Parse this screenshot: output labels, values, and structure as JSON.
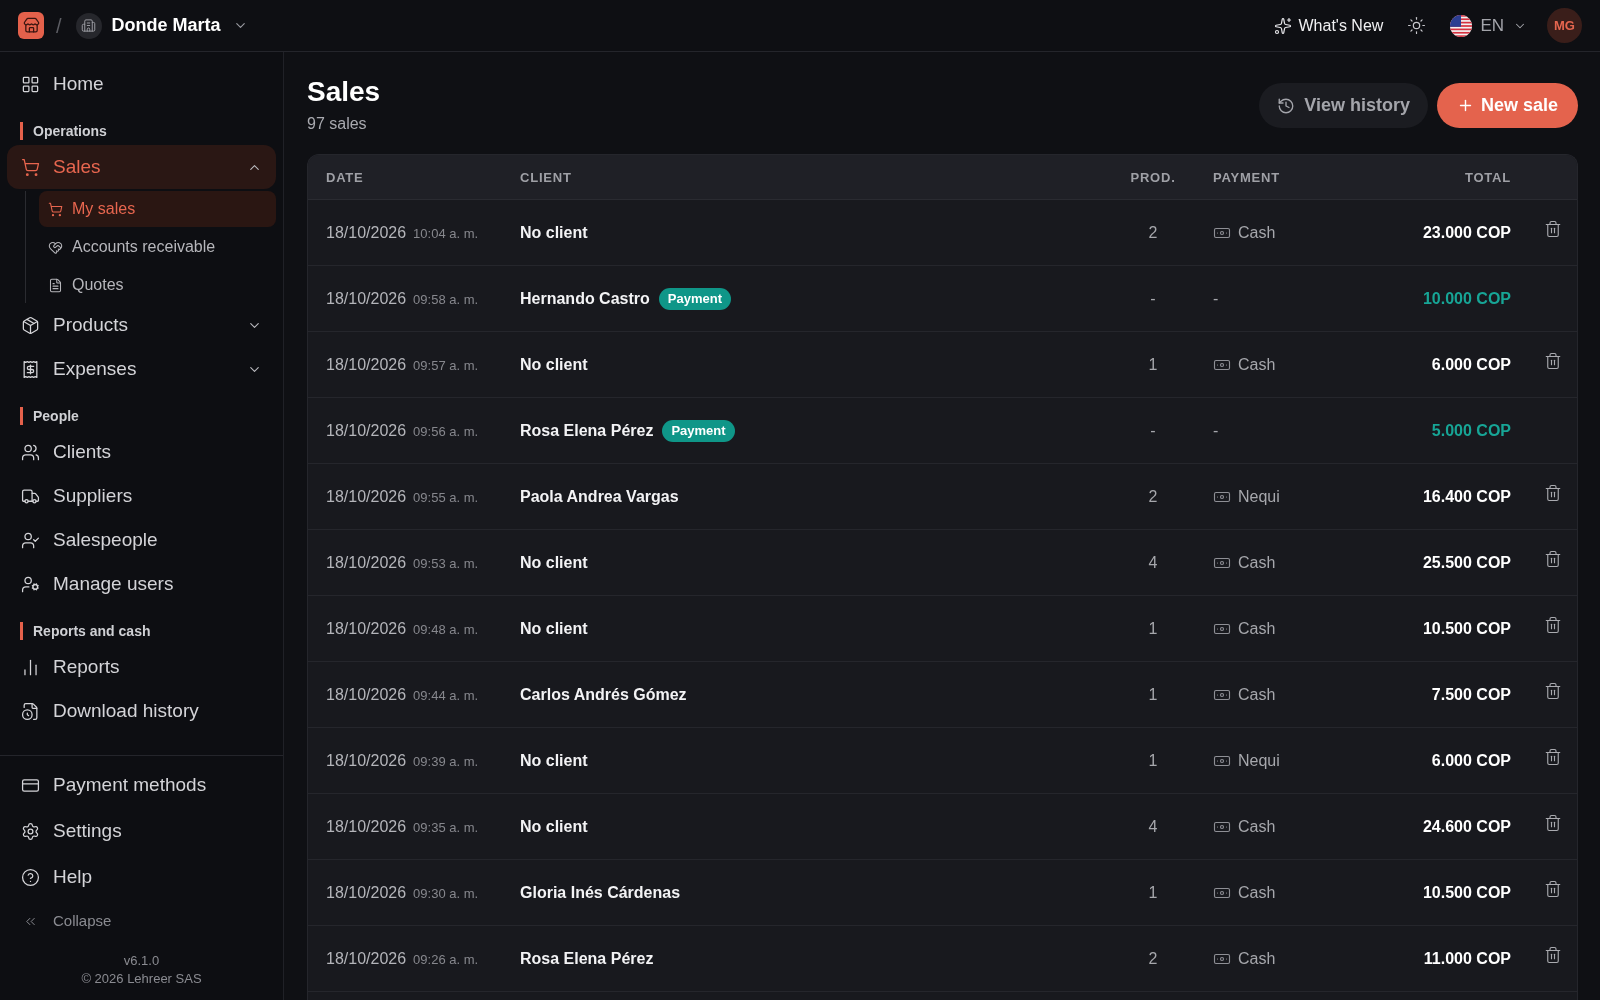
{
  "topbar": {
    "separator": "/",
    "workspace": "Donde Marta",
    "whats_new": "What's New",
    "language": "EN",
    "avatar": "MG"
  },
  "sidebar": {
    "nav": [
      {
        "kind": "link",
        "label": "Home",
        "selected": false
      },
      {
        "kind": "section",
        "label": "Operations"
      },
      {
        "kind": "group",
        "label": "Sales",
        "selected": true,
        "expanded": true,
        "children": [
          {
            "label": "My sales",
            "selected": true
          },
          {
            "label": "Accounts receivable",
            "selected": false
          },
          {
            "label": "Quotes",
            "selected": false
          }
        ]
      },
      {
        "kind": "group",
        "label": "Products",
        "selected": false,
        "expanded": false
      },
      {
        "kind": "group",
        "label": "Expenses",
        "selected": false,
        "expanded": false
      },
      {
        "kind": "section",
        "label": "People"
      },
      {
        "kind": "link",
        "label": "Clients",
        "selected": false
      },
      {
        "kind": "link",
        "label": "Suppliers",
        "selected": false
      },
      {
        "kind": "link",
        "label": "Salespeople",
        "selected": false
      },
      {
        "kind": "link",
        "label": "Manage users",
        "selected": false
      },
      {
        "kind": "section",
        "label": "Reports and cash"
      },
      {
        "kind": "link",
        "label": "Reports",
        "selected": false
      },
      {
        "kind": "link",
        "label": "Download history",
        "selected": false
      }
    ],
    "footer_nav": [
      {
        "label": "Payment methods"
      },
      {
        "label": "Settings"
      },
      {
        "label": "Help"
      }
    ],
    "collapse": "Collapse",
    "version": "v6.1.0",
    "copyright": "© 2026 Lehreer SAS"
  },
  "page": {
    "title": "Sales",
    "subtitle": "97 sales",
    "actions": [
      {
        "kind": "secondary",
        "label": "View history"
      },
      {
        "kind": "primary",
        "label": "New sale"
      }
    ]
  },
  "table": {
    "columns": [
      "DATE",
      "CLIENT",
      "PROD.",
      "PAYMENT",
      "TOTAL"
    ],
    "rows": [
      {
        "kind": "sale",
        "date": "18/10/2026",
        "time": "10:04 a. m.",
        "client": "No client",
        "products": "2",
        "payment": "Cash",
        "total": "23.000 COP"
      },
      {
        "kind": "payment",
        "date": "18/10/2026",
        "time": "09:58 a. m.",
        "client": "Hernando Castro",
        "badge": "Payment",
        "products": "-",
        "payment": "-",
        "total": "10.000 COP"
      },
      {
        "kind": "sale",
        "date": "18/10/2026",
        "time": "09:57 a. m.",
        "client": "No client",
        "products": "1",
        "payment": "Cash",
        "total": "6.000 COP"
      },
      {
        "kind": "payment",
        "date": "18/10/2026",
        "time": "09:56 a. m.",
        "client": "Rosa Elena Pérez",
        "badge": "Payment",
        "products": "-",
        "payment": "-",
        "total": "5.000 COP"
      },
      {
        "kind": "sale",
        "date": "18/10/2026",
        "time": "09:55 a. m.",
        "client": "Paola Andrea Vargas",
        "products": "2",
        "payment": "Nequi",
        "total": "16.400 COP"
      },
      {
        "kind": "sale",
        "date": "18/10/2026",
        "time": "09:53 a. m.",
        "client": "No client",
        "products": "4",
        "payment": "Cash",
        "total": "25.500 COP"
      },
      {
        "kind": "sale",
        "date": "18/10/2026",
        "time": "09:48 a. m.",
        "client": "No client",
        "products": "1",
        "payment": "Cash",
        "total": "10.500 COP"
      },
      {
        "kind": "sale",
        "date": "18/10/2026",
        "time": "09:44 a. m.",
        "client": "Carlos Andrés Gómez",
        "products": "1",
        "payment": "Cash",
        "total": "7.500 COP"
      },
      {
        "kind": "sale",
        "date": "18/10/2026",
        "time": "09:39 a. m.",
        "client": "No client",
        "products": "1",
        "payment": "Nequi",
        "total": "6.000 COP"
      },
      {
        "kind": "sale",
        "date": "18/10/2026",
        "time": "09:35 a. m.",
        "client": "No client",
        "products": "4",
        "payment": "Cash",
        "total": "24.600 COP"
      },
      {
        "kind": "sale",
        "date": "18/10/2026",
        "time": "09:30 a. m.",
        "client": "Gloria Inés Cárdenas",
        "products": "1",
        "payment": "Cash",
        "total": "10.500 COP"
      },
      {
        "kind": "sale",
        "date": "18/10/2026",
        "time": "09:26 a. m.",
        "client": "Rosa Elena Pérez",
        "products": "2",
        "payment": "Cash",
        "total": "11.000 COP"
      }
    ]
  }
}
